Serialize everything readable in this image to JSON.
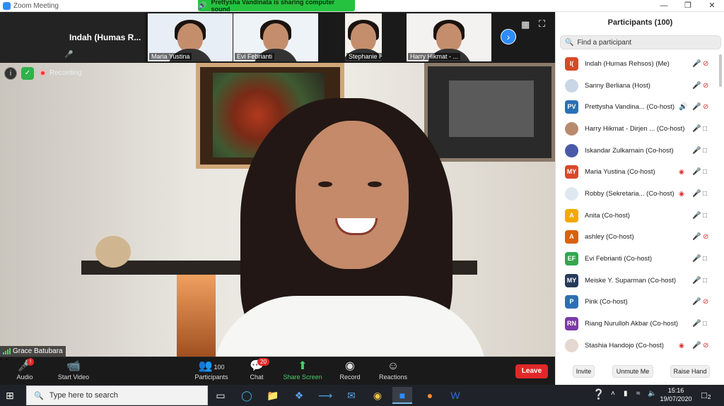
{
  "window": {
    "title": "Zoom Meeting",
    "controls": [
      "—",
      "❐",
      "✕"
    ]
  },
  "share_banner": "Prettysha Vandinata is sharing computer sound",
  "strip": {
    "active_name": "Indah (Humas R...",
    "tiles": [
      {
        "label": "Maria Yustina",
        "bg": "#e8eef6"
      },
      {
        "label": "Evi Febrianti",
        "bg": "#eef3f8"
      },
      {
        "label": "Stephanie Hand...",
        "bg": "#f6f3ee"
      },
      {
        "label": "Harry Hikmat - ...",
        "bg": "#f4f1f1"
      }
    ]
  },
  "main_video": {
    "speaker_name": "Grace Batubara",
    "recording_label": "Recording"
  },
  "controls": {
    "audio": "Audio",
    "start_video": "Start Video",
    "participants": "Participants",
    "participants_count": "100",
    "chat": "Chat",
    "chat_badge": "20",
    "share_screen": "Share Screen",
    "record": "Record",
    "reactions": "Reactions",
    "leave": "Leave"
  },
  "panel": {
    "title": "Participants (100)",
    "search_placeholder": "Find a participant",
    "participants": [
      {
        "name": "Indah (Humas Rehsos) (Me)",
        "avatar": "I(",
        "color": "#d9482b",
        "photo": false,
        "rec": false,
        "speaking": false,
        "mic": "muted",
        "cam": "off"
      },
      {
        "name": "Sanny Berliana (Host)",
        "avatar": "",
        "color": "#c9d6e6",
        "photo": true,
        "rec": false,
        "speaking": false,
        "mic": "muted",
        "cam": "off"
      },
      {
        "name": "Prettysha Vandina... (Co-host)",
        "avatar": "PV",
        "color": "#2d6fb7",
        "photo": false,
        "rec": false,
        "speaking": true,
        "mic": "muted",
        "cam": "off"
      },
      {
        "name": "Harry Hikmat - Dirjen ... (Co-host)",
        "avatar": "",
        "color": "#b98a6e",
        "photo": true,
        "rec": false,
        "speaking": false,
        "mic": "on",
        "cam": "on"
      },
      {
        "name": "Iskandar Zulkarnain (Co-host)",
        "avatar": "",
        "color": "#4a5aa8",
        "photo": true,
        "rec": false,
        "speaking": false,
        "mic": "on",
        "cam": "on"
      },
      {
        "name": "Maria Yustina (Co-host)",
        "avatar": "MY",
        "color": "#d9482b",
        "photo": false,
        "rec": true,
        "speaking": false,
        "mic": "on",
        "cam": "on"
      },
      {
        "name": "Robby (Sekretaria... (Co-host)",
        "avatar": "",
        "color": "#dfe8f0",
        "photo": true,
        "rec": true,
        "speaking": false,
        "mic": "on",
        "cam": "on"
      },
      {
        "name": "Anita (Co-host)",
        "avatar": "A",
        "color": "#f2a900",
        "photo": false,
        "rec": false,
        "speaking": false,
        "mic": "muted",
        "cam": "on"
      },
      {
        "name": "ashley (Co-host)",
        "avatar": "A",
        "color": "#d9620b",
        "photo": false,
        "rec": false,
        "speaking": false,
        "mic": "muted",
        "cam": "off"
      },
      {
        "name": "Evi Febrianti (Co-host)",
        "avatar": "EF",
        "color": "#2fa84f",
        "photo": false,
        "rec": false,
        "speaking": false,
        "mic": "muted",
        "cam": "on"
      },
      {
        "name": "Meiske Y. Suparman (Co-host)",
        "avatar": "MY",
        "color": "#263a5a",
        "photo": false,
        "rec": false,
        "speaking": false,
        "mic": "muted",
        "cam": "on"
      },
      {
        "name": "Pink (Co-host)",
        "avatar": "P",
        "color": "#2d6fb7",
        "photo": false,
        "rec": false,
        "speaking": false,
        "mic": "muted",
        "cam": "off"
      },
      {
        "name": "Riang Nurulloh Akbar (Co-host)",
        "avatar": "RN",
        "color": "#7a3aa8",
        "photo": false,
        "rec": false,
        "speaking": false,
        "mic": "muted",
        "cam": "on"
      },
      {
        "name": "Stashia Handojo (Co-host)",
        "avatar": "",
        "color": "#e5d8d0",
        "photo": true,
        "rec": true,
        "speaking": false,
        "mic": "muted",
        "cam": "off"
      }
    ],
    "buttons": {
      "invite": "Invite",
      "unmute_me": "Unmute Me",
      "raise_hand": "Raise Hand"
    }
  },
  "taskbar": {
    "search_placeholder": "Type here to search",
    "time": "15:16",
    "date": "19/07/2020",
    "notifications": "2"
  }
}
